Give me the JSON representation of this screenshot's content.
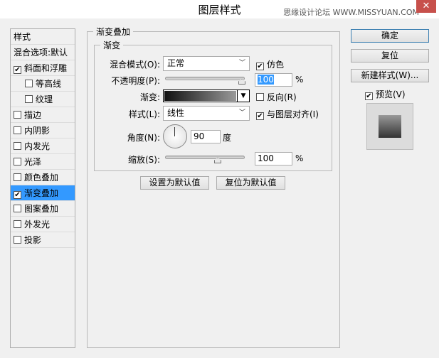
{
  "window": {
    "title": "图层样式",
    "watermark": "思缘设计论坛 WWW.MISSYUAN.COM",
    "close_icon": "close-icon"
  },
  "sidebar": {
    "items": [
      {
        "label": "样式",
        "checkbox": false
      },
      {
        "label": "混合选项:默认",
        "checkbox": false
      },
      {
        "label": "斜面和浮雕",
        "checkbox": true,
        "checked": true
      },
      {
        "label": "等高线",
        "checkbox": true,
        "checked": false,
        "indent": true
      },
      {
        "label": "纹理",
        "checkbox": true,
        "checked": false,
        "indent": true
      },
      {
        "label": "描边",
        "checkbox": true,
        "checked": false
      },
      {
        "label": "内阴影",
        "checkbox": true,
        "checked": false
      },
      {
        "label": "内发光",
        "checkbox": true,
        "checked": false
      },
      {
        "label": "光泽",
        "checkbox": true,
        "checked": false
      },
      {
        "label": "颜色叠加",
        "checkbox": true,
        "checked": false
      },
      {
        "label": "渐变叠加",
        "checkbox": true,
        "checked": true,
        "selected": true
      },
      {
        "label": "图案叠加",
        "checkbox": true,
        "checked": false
      },
      {
        "label": "外发光",
        "checkbox": true,
        "checked": false
      },
      {
        "label": "投影",
        "checkbox": true,
        "checked": false
      }
    ]
  },
  "main": {
    "group_title": "渐变叠加",
    "sub_title": "渐变",
    "blend_label": "混合模式(O):",
    "blend_value": "正常",
    "dither_label": "仿色",
    "dither_checked": true,
    "opacity_label": "不透明度(P):",
    "opacity_value": "100",
    "opacity_unit": "%",
    "opacity_percent": 100,
    "gradient_label": "渐变:",
    "reverse_label": "反向(R)",
    "reverse_checked": false,
    "style_label": "样式(L):",
    "style_value": "线性",
    "align_label": "与图层对齐(I)",
    "align_checked": true,
    "angle_label": "角度(N):",
    "angle_value": "90",
    "angle_unit": "度",
    "scale_label": "缩放(S):",
    "scale_value": "100",
    "scale_unit": "%",
    "scale_percent": 100,
    "set_default": "设置为默认值",
    "reset_default": "复位为默认值"
  },
  "actions": {
    "ok": "确定",
    "reset": "复位",
    "new_style": "新建样式(W)...",
    "preview_label": "预览(V)",
    "preview_checked": true
  }
}
